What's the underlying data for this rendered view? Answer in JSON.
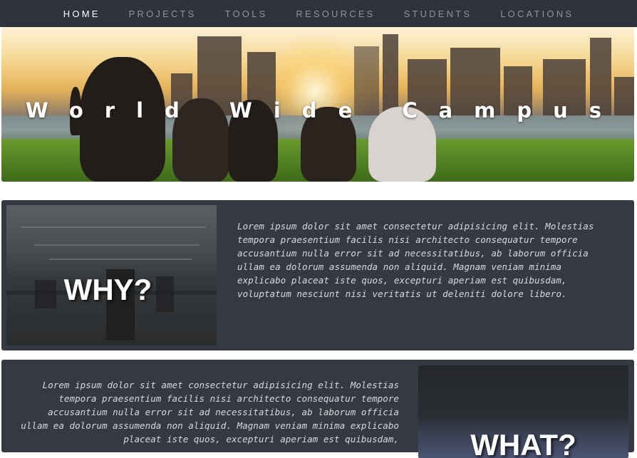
{
  "nav": {
    "items": [
      {
        "label": "HOME",
        "active": true
      },
      {
        "label": "PROJECTS",
        "active": false
      },
      {
        "label": "TOOLS",
        "active": false
      },
      {
        "label": "RESOURCES",
        "active": false
      },
      {
        "label": "STUDENTS",
        "active": false
      },
      {
        "label": "LOCATIONS",
        "active": false
      }
    ]
  },
  "hero": {
    "title": "World Wide Campus"
  },
  "sections": {
    "why": {
      "heading": "WHY?",
      "text": "Lorem ipsum dolor sit amet consectetur adipisicing elit. Molestias tempora praesentium facilis nisi architecto consequatur tempore accusantium nulla error sit ad necessitatibus, ab laborum officia ullam ea dolorum assumenda non aliquid. Magnam veniam minima explicabo placeat iste quos, excepturi aperiam est quibusdam, voluptatum nesciunt nisi veritatis ut deleniti dolore libero."
    },
    "what": {
      "heading": "WHAT?",
      "text": "Lorem ipsum dolor sit amet consectetur adipisicing elit. Molestias tempora praesentium facilis nisi architecto consequatur tempore accusantium nulla error sit ad necessitatibus, ab laborum officia ullam ea dolorum assumenda non aliquid. Magnam veniam minima explicabo placeat iste quos, excepturi aperiam est quibusdam,"
    }
  },
  "colors": {
    "nav_bg": "#2f333d",
    "nav_text": "#8e929a",
    "nav_active": "#ffffff",
    "section_bg": "#353942",
    "section_text": "#d7d9dc"
  }
}
